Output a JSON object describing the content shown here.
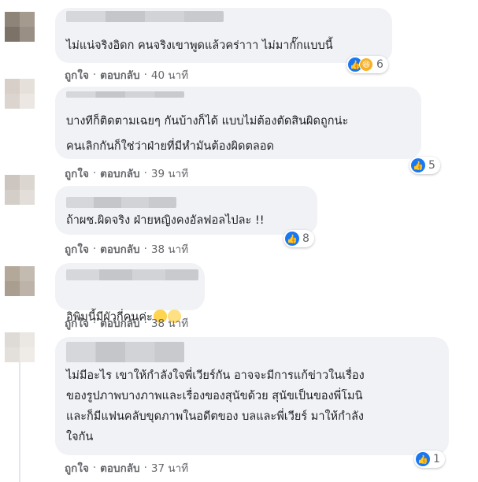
{
  "comments": [
    {
      "text": "ไม่แน่จริงอิดก คนจริงเขาพูดแล้วคร่าาา ไม่มากั๊กแบบนี้",
      "reaction_count": "6",
      "like_label": "ถูกใจ",
      "reply_label": "ตอบกลับ",
      "time": "40 นาที"
    },
    {
      "text": "บางทีก็ติดตามเฉยๆ กันบ้างก็ได้ แบบไม่ต้องตัดสินผิดถูกน่ะ\nคนเลิกกันก็ใช่ว่าฝ่ายที่มีหำมันต้องผิดตลอด",
      "reaction_count": "5",
      "like_label": "ถูกใจ",
      "reply_label": "ตอบกลับ",
      "time": "39 นาที"
    },
    {
      "text": "ถ้าผช.ผิดจริง ฝ่ายหญิงคงอัลฟอลไปละ !!",
      "reaction_count": "8",
      "like_label": "ถูกใจ",
      "reply_label": "ตอบกลับ",
      "time": "38 นาที"
    },
    {
      "text": "อิพิมนี้มีผัวกี่คนค่ะ",
      "reaction_count": "",
      "like_label": "ถูกใจ",
      "reply_label": "ตอบกลับ",
      "time": "38 นาที"
    },
    {
      "text": "ไม่มีอะไร เขาให้กำลังใจพี่เวียร์กัน อาจจะมีการแก้ข่าวในเรื่อง\nของรูปภาพบางภาพและเรื่องของสุนัขด้วย สุนัขเป็นของพี่โมนิ\nและก็มีแฟนคลับขุดภาพในอดีตของ บลและพี่เวียร์ มาให้กำลัง\nใจกัน",
      "reaction_count": "1",
      "like_label": "ถูกใจ",
      "reply_label": "ตอบกลับ",
      "time": "37 นาที"
    }
  ],
  "separator": "·",
  "icons": {
    "like": "thumbs-up-icon",
    "haha": "laughing-face-icon"
  },
  "colors": {
    "bubble": "#f0f2f5",
    "like_blue": "#1877f2",
    "meta_gray": "#65676b"
  }
}
